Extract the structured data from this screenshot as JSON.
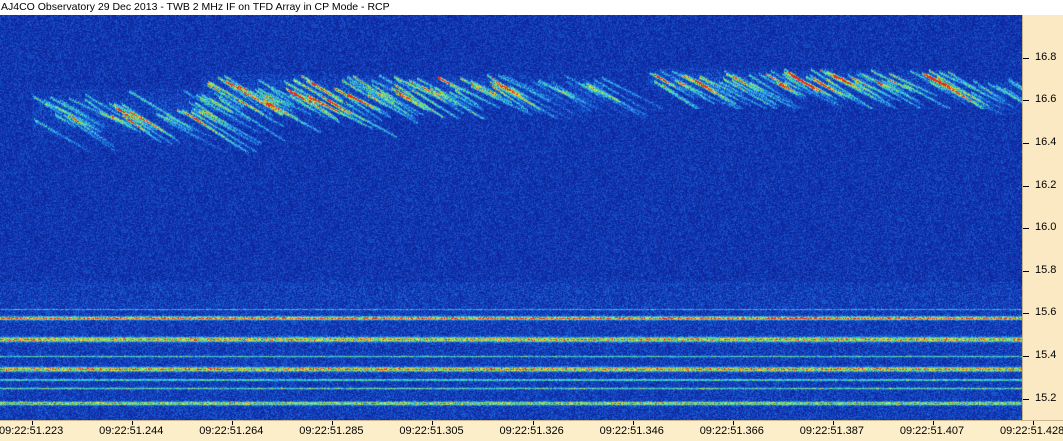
{
  "window": {
    "title": "AJ4CO Observatory 29 Dec 2013 - TWB 2 MHz IF on TFD Array in CP Mode - RCP"
  },
  "colors": {
    "background_low": "#0a2aa0",
    "mid": "#1f7ad8",
    "high": "#3fd4b0",
    "peak": "#ff4a2a",
    "axis_bg": "#fbeec8"
  },
  "chart_data": {
    "type": "heatmap",
    "title": "AJ4CO Observatory 29 Dec 2013 - TWB 2 MHz IF on TFD Array in CP Mode - RCP",
    "colormap": "jet-like (blue low → cyan/green → yellow → red high)",
    "xlabel": "",
    "ylabel": "",
    "x_tick_labels": [
      "09:22:51.223",
      "09:22:51.244",
      "09:22:51.264",
      "09:22:51.285",
      "09:22:51.305",
      "09:22:51.326",
      "09:22:51.346",
      "09:22:51.366",
      "09:22:51.387",
      "09:22:51.407",
      "09:22:51.428"
    ],
    "y_tick_labels": [
      "15.2",
      "15.4",
      "15.6",
      "15.8",
      "16.0",
      "16.2",
      "16.4",
      "16.6",
      "16.8"
    ],
    "y_ticks": [
      15.2,
      15.4,
      15.6,
      15.8,
      16.0,
      16.2,
      16.4,
      16.6,
      16.8
    ],
    "ylim": [
      15.1,
      17.0
    ],
    "y_axis_side": "right",
    "features": {
      "s_burst_band_mhz": [
        16.35,
        16.75
      ],
      "horizontal_interference_lines_mhz": [
        15.18,
        15.25,
        15.29,
        15.34,
        15.48,
        15.58
      ],
      "burst_clusters": [
        {
          "time_start": "09:22:51.223",
          "time_end": "09:22:51.258",
          "freq_low": 16.35,
          "freq_high": 16.65,
          "intensity": 0.55
        },
        {
          "time_start": "09:22:51.258",
          "time_end": "09:22:51.292",
          "freq_low": 16.45,
          "freq_high": 16.72,
          "intensity": 0.75
        },
        {
          "time_start": "09:22:51.292",
          "time_end": "09:22:51.318",
          "freq_low": 16.55,
          "freq_high": 16.72,
          "intensity": 0.65
        },
        {
          "time_start": "09:22:51.318",
          "time_end": "09:22:51.340",
          "freq_low": 16.55,
          "freq_high": 16.72,
          "intensity": 0.35
        },
        {
          "time_start": "09:22:51.349",
          "time_end": "09:22:51.412",
          "freq_low": 16.6,
          "freq_high": 16.75,
          "intensity": 0.6
        },
        {
          "time_start": "09:22:51.412",
          "time_end": "09:22:51.428",
          "freq_low": 16.57,
          "freq_high": 16.7,
          "intensity": 0.4
        }
      ]
    }
  }
}
